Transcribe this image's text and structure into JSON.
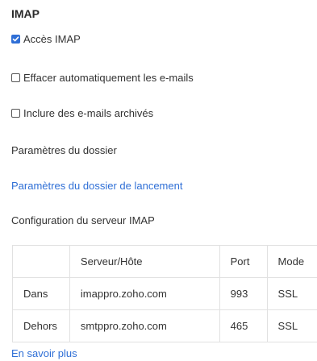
{
  "section_title": "IMAP",
  "options": [
    {
      "label": "Accès IMAP",
      "checked": true
    },
    {
      "label": "Effacer automatiquement les e-mails",
      "checked": false
    },
    {
      "label": "Inclure des e-mails archivés",
      "checked": false
    }
  ],
  "folder_settings": {
    "label": "Paramètres du dossier",
    "link": "Paramètres du dossier de lancement"
  },
  "server_config": {
    "label": "Configuration du serveur IMAP",
    "headers": [
      "",
      "Serveur/Hôte",
      "Port",
      "Mode"
    ],
    "rows": [
      {
        "direction": "Dans",
        "host": "imappro.zoho.com",
        "port": "993",
        "mode": "SSL"
      },
      {
        "direction": "Dehors",
        "host": "smtppro.zoho.com",
        "port": "465",
        "mode": "SSL"
      }
    ]
  },
  "learn_more": "En savoir plus",
  "colors": {
    "accent": "#2f6fd6",
    "text": "#333333",
    "border": "#e1e1e1"
  }
}
